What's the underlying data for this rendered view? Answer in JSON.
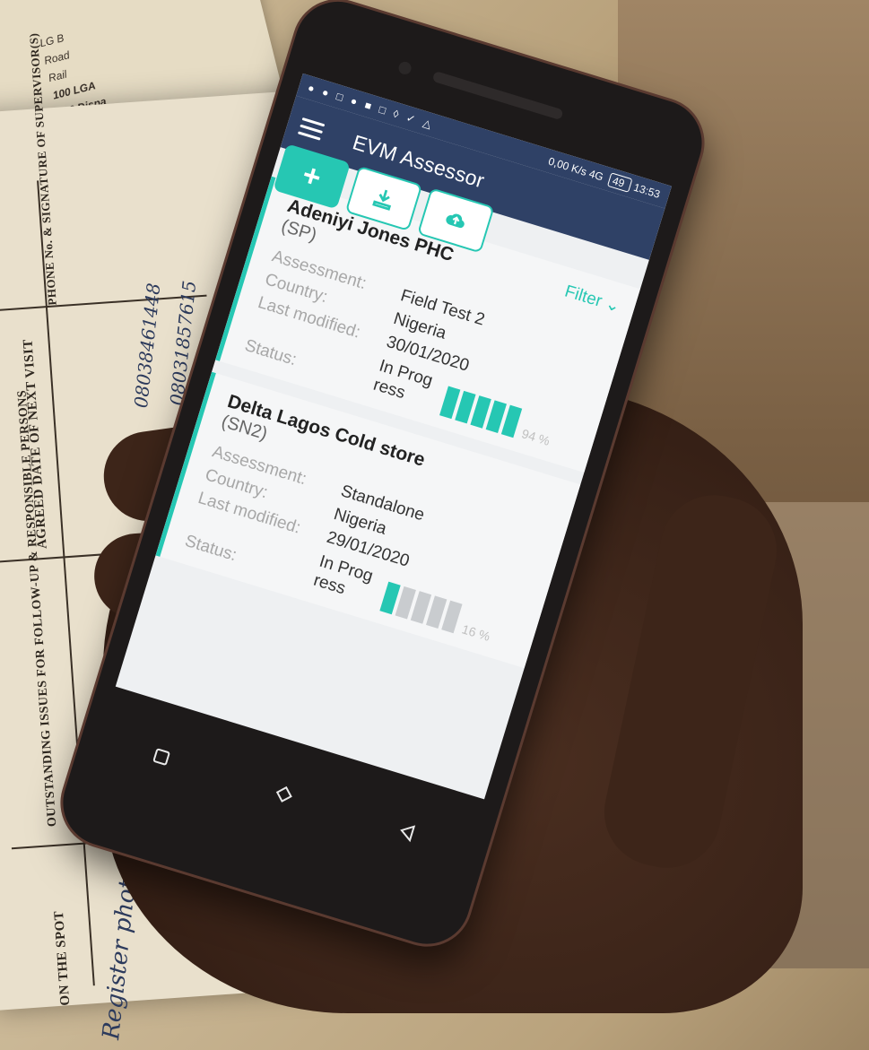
{
  "statusbar": {
    "speed": "0,00 K/s",
    "network": "4G",
    "battery": "49",
    "time": "13:53"
  },
  "app": {
    "title": "EVM Assessor",
    "add_label": "+",
    "filter_label": "Filter ⌄"
  },
  "labels": {
    "assessment": "Assessment:",
    "country": "Country:",
    "last_modified": "Last modified:",
    "status": "Status:"
  },
  "cards": [
    {
      "name": "Adeniyi Jones PHC",
      "code": "(SP)",
      "assessment": "Field Test 2",
      "country": "Nigeria",
      "last_modified": "30/01/2020",
      "status": "In Prog ress",
      "progress": 0.94,
      "progress_label": "94 %"
    },
    {
      "name": "Delta Lagos Cold store",
      "code": "(SN2)",
      "assessment": "Standalone",
      "country": "Nigeria",
      "last_modified": "29/01/2020",
      "status": "In Prog ress",
      "progress": 0.16,
      "progress_label": "16 %"
    }
  ],
  "paper": {
    "headers": [
      "PHONE No. & SIGNATURE OF SUPERVISOR(S)",
      "AGREED DATE OF NEXT VISIT",
      "OUTSTANDING ISSUES FOR FOLLOW-UP & RESPONSIBLE PERSONS",
      "ON THE SPOT"
    ],
    "legend": [
      "LG B",
      "Road",
      "Rail",
      "100 LGA",
      "106 Dispa"
    ],
    "handwriting": [
      "08038461448",
      "08031857615",
      "Register photocopy"
    ]
  },
  "colors": {
    "accent": "#26c7b3",
    "appbar": "#2f4166"
  }
}
